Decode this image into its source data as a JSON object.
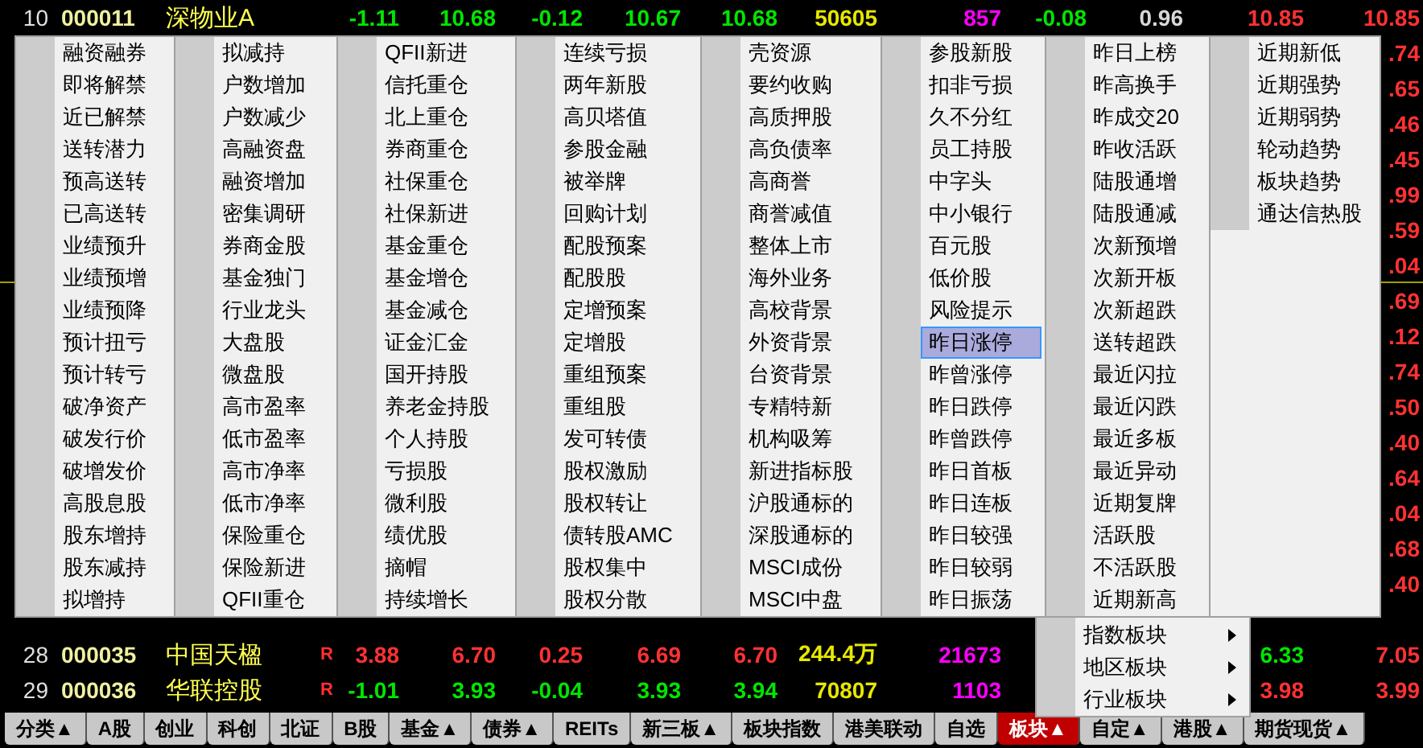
{
  "rows_top": [
    {
      "index": "10",
      "code": "000011",
      "name": "深物业A",
      "values": [
        {
          "text": "-1.11",
          "kind": "down"
        },
        {
          "text": "10.68",
          "kind": "down"
        },
        {
          "text": "-0.12",
          "kind": "down"
        },
        {
          "text": "10.67",
          "kind": "down"
        },
        {
          "text": "10.68",
          "kind": "down"
        },
        {
          "text": "50605",
          "kind": "vol"
        },
        {
          "text": "857",
          "kind": "count"
        },
        {
          "text": "-0.08",
          "kind": "down"
        },
        {
          "text": "0.96",
          "kind": "flat"
        },
        {
          "text": "10.85",
          "kind": "up"
        },
        {
          "text": "10.85",
          "kind": "up"
        }
      ]
    }
  ],
  "covered_rows": [
    {
      "fragment": ".74",
      "kind": "up",
      "divider_below": false
    },
    {
      "fragment": ".65",
      "kind": "up",
      "divider_below": false
    },
    {
      "fragment": ".46",
      "kind": "up",
      "divider_below": false
    },
    {
      "fragment": ".45",
      "kind": "up",
      "divider_below": false
    },
    {
      "fragment": ".99",
      "kind": "up",
      "divider_below": false
    },
    {
      "fragment": ".59",
      "kind": "up",
      "divider_below": false
    },
    {
      "fragment": ".04",
      "kind": "up",
      "divider_below": true
    },
    {
      "fragment": ".69",
      "kind": "up",
      "divider_below": false
    },
    {
      "fragment": ".12",
      "kind": "up",
      "divider_below": false
    },
    {
      "fragment": ".74",
      "kind": "up",
      "divider_below": false
    },
    {
      "fragment": ".50",
      "kind": "up",
      "divider_below": false
    },
    {
      "fragment": ".40",
      "kind": "up",
      "divider_below": false
    },
    {
      "fragment": ".64",
      "kind": "up",
      "divider_below": false
    },
    {
      "fragment": ".04",
      "kind": "up",
      "divider_below": false
    },
    {
      "fragment": ".68",
      "kind": "up",
      "divider_below": false
    },
    {
      "fragment": ".40",
      "kind": "up",
      "divider_below": false
    }
  ],
  "rows_bottom": [
    {
      "index": "28",
      "code": "000035",
      "name": "中国天楹",
      "flag": "R",
      "values": [
        {
          "text": "3.88",
          "kind": "up"
        },
        {
          "text": "6.70",
          "kind": "up"
        },
        {
          "text": "0.25",
          "kind": "up"
        },
        {
          "text": "6.69",
          "kind": "up"
        },
        {
          "text": "6.70",
          "kind": "up"
        },
        {
          "text": "244.4万",
          "kind": "vol"
        },
        {
          "text": "21673",
          "kind": "count"
        },
        {
          "text": "6.33",
          "kind": "down"
        },
        {
          "text": "7.05",
          "kind": "up"
        }
      ]
    },
    {
      "index": "29",
      "code": "000036",
      "name": "华联控股",
      "flag": "R",
      "values": [
        {
          "text": "-1.01",
          "kind": "down"
        },
        {
          "text": "3.93",
          "kind": "down"
        },
        {
          "text": "-0.04",
          "kind": "down"
        },
        {
          "text": "3.93",
          "kind": "down"
        },
        {
          "text": "3.94",
          "kind": "down"
        },
        {
          "text": "70807",
          "kind": "vol"
        },
        {
          "text": "1103",
          "kind": "count"
        },
        {
          "text": "3.98",
          "kind": "up"
        },
        {
          "text": "3.99",
          "kind": "up"
        }
      ]
    }
  ],
  "menu": {
    "columns": [
      [
        {
          "label": "融资融券",
          "selected": false
        },
        {
          "label": "即将解禁",
          "selected": false
        },
        {
          "label": "近已解禁",
          "selected": false
        },
        {
          "label": "送转潜力",
          "selected": false
        },
        {
          "label": "预高送转",
          "selected": false
        },
        {
          "label": "已高送转",
          "selected": false
        },
        {
          "label": "业绩预升",
          "selected": false
        },
        {
          "label": "业绩预增",
          "selected": false
        },
        {
          "label": "业绩预降",
          "selected": false
        },
        {
          "label": "预计扭亏",
          "selected": false
        },
        {
          "label": "预计转亏",
          "selected": false
        },
        {
          "label": "破净资产",
          "selected": false
        },
        {
          "label": "破发行价",
          "selected": false
        },
        {
          "label": "破增发价",
          "selected": false
        },
        {
          "label": "高股息股",
          "selected": false
        },
        {
          "label": "股东增持",
          "selected": false
        },
        {
          "label": "股东减持",
          "selected": false
        },
        {
          "label": "拟增持",
          "selected": false
        }
      ],
      [
        {
          "label": "拟减持",
          "selected": false
        },
        {
          "label": "户数增加",
          "selected": false
        },
        {
          "label": "户数减少",
          "selected": false
        },
        {
          "label": "高融资盘",
          "selected": false
        },
        {
          "label": "融资增加",
          "selected": false
        },
        {
          "label": "密集调研",
          "selected": false
        },
        {
          "label": "券商金股",
          "selected": false
        },
        {
          "label": "基金独门",
          "selected": false
        },
        {
          "label": "行业龙头",
          "selected": false
        },
        {
          "label": "大盘股",
          "selected": false
        },
        {
          "label": "微盘股",
          "selected": false
        },
        {
          "label": "高市盈率",
          "selected": false
        },
        {
          "label": "低市盈率",
          "selected": false
        },
        {
          "label": "高市净率",
          "selected": false
        },
        {
          "label": "低市净率",
          "selected": false
        },
        {
          "label": "保险重仓",
          "selected": false
        },
        {
          "label": "保险新进",
          "selected": false
        },
        {
          "label": "QFII重仓",
          "selected": false
        }
      ],
      [
        {
          "label": "QFII新进",
          "selected": false
        },
        {
          "label": "信托重仓",
          "selected": false
        },
        {
          "label": "北上重仓",
          "selected": false
        },
        {
          "label": "券商重仓",
          "selected": false
        },
        {
          "label": "社保重仓",
          "selected": false
        },
        {
          "label": "社保新进",
          "selected": false
        },
        {
          "label": "基金重仓",
          "selected": false
        },
        {
          "label": "基金增仓",
          "selected": false
        },
        {
          "label": "基金减仓",
          "selected": false
        },
        {
          "label": "证金汇金",
          "selected": false
        },
        {
          "label": "国开持股",
          "selected": false
        },
        {
          "label": "养老金持股",
          "selected": false
        },
        {
          "label": "个人持股",
          "selected": false
        },
        {
          "label": "亏损股",
          "selected": false
        },
        {
          "label": "微利股",
          "selected": false
        },
        {
          "label": "绩优股",
          "selected": false
        },
        {
          "label": "摘帽",
          "selected": false
        },
        {
          "label": "持续增长",
          "selected": false
        }
      ],
      [
        {
          "label": "连续亏损",
          "selected": false
        },
        {
          "label": "两年新股",
          "selected": false
        },
        {
          "label": "高贝塔值",
          "selected": false
        },
        {
          "label": "参股金融",
          "selected": false
        },
        {
          "label": "被举牌",
          "selected": false
        },
        {
          "label": "回购计划",
          "selected": false
        },
        {
          "label": "配股预案",
          "selected": false
        },
        {
          "label": "配股股",
          "selected": false
        },
        {
          "label": "定增预案",
          "selected": false
        },
        {
          "label": "定增股",
          "selected": false
        },
        {
          "label": "重组预案",
          "selected": false
        },
        {
          "label": "重组股",
          "selected": false
        },
        {
          "label": "发可转债",
          "selected": false
        },
        {
          "label": "股权激励",
          "selected": false
        },
        {
          "label": "股权转让",
          "selected": false
        },
        {
          "label": "债转股AMC",
          "selected": false
        },
        {
          "label": "股权集中",
          "selected": false
        },
        {
          "label": "股权分散",
          "selected": false
        }
      ],
      [
        {
          "label": "壳资源",
          "selected": false
        },
        {
          "label": "要约收购",
          "selected": false
        },
        {
          "label": "高质押股",
          "selected": false
        },
        {
          "label": "高负债率",
          "selected": false
        },
        {
          "label": "高商誉",
          "selected": false
        },
        {
          "label": "商誉减值",
          "selected": false
        },
        {
          "label": "整体上市",
          "selected": false
        },
        {
          "label": "海外业务",
          "selected": false
        },
        {
          "label": "高校背景",
          "selected": false
        },
        {
          "label": "外资背景",
          "selected": false
        },
        {
          "label": "台资背景",
          "selected": false
        },
        {
          "label": "专精特新",
          "selected": false
        },
        {
          "label": "机构吸筹",
          "selected": false
        },
        {
          "label": "新进指标股",
          "selected": false
        },
        {
          "label": "沪股通标的",
          "selected": false
        },
        {
          "label": "深股通标的",
          "selected": false
        },
        {
          "label": "MSCI成份",
          "selected": false
        },
        {
          "label": "MSCI中盘",
          "selected": false
        }
      ],
      [
        {
          "label": "参股新股",
          "selected": false
        },
        {
          "label": "扣非亏损",
          "selected": false
        },
        {
          "label": "久不分红",
          "selected": false
        },
        {
          "label": "员工持股",
          "selected": false
        },
        {
          "label": "中字头",
          "selected": false
        },
        {
          "label": "中小银行",
          "selected": false
        },
        {
          "label": "百元股",
          "selected": false
        },
        {
          "label": "低价股",
          "selected": false
        },
        {
          "label": "风险提示",
          "selected": false
        },
        {
          "label": "昨日涨停",
          "selected": true
        },
        {
          "label": "昨曾涨停",
          "selected": false
        },
        {
          "label": "昨日跌停",
          "selected": false
        },
        {
          "label": "昨曾跌停",
          "selected": false
        },
        {
          "label": "昨日首板",
          "selected": false
        },
        {
          "label": "昨日连板",
          "selected": false
        },
        {
          "label": "昨日较强",
          "selected": false
        },
        {
          "label": "昨日较弱",
          "selected": false
        },
        {
          "label": "昨日振荡",
          "selected": false
        }
      ],
      [
        {
          "label": "昨日上榜",
          "selected": false
        },
        {
          "label": "昨高换手",
          "selected": false
        },
        {
          "label": "昨成交20",
          "selected": false
        },
        {
          "label": "昨收活跃",
          "selected": false
        },
        {
          "label": "陆股通增",
          "selected": false
        },
        {
          "label": "陆股通减",
          "selected": false
        },
        {
          "label": "次新预增",
          "selected": false
        },
        {
          "label": "次新开板",
          "selected": false
        },
        {
          "label": "次新超跌",
          "selected": false
        },
        {
          "label": "送转超跌",
          "selected": false
        },
        {
          "label": "最近闪拉",
          "selected": false
        },
        {
          "label": "最近闪跌",
          "selected": false
        },
        {
          "label": "最近多板",
          "selected": false
        },
        {
          "label": "最近异动",
          "selected": false
        },
        {
          "label": "近期复牌",
          "selected": false
        },
        {
          "label": "活跃股",
          "selected": false
        },
        {
          "label": "不活跃股",
          "selected": false
        },
        {
          "label": "近期新高",
          "selected": false
        }
      ],
      [
        {
          "label": "近期新低",
          "selected": false
        },
        {
          "label": "近期强势",
          "selected": false
        },
        {
          "label": "近期弱势",
          "selected": false
        },
        {
          "label": "轮动趋势",
          "selected": false
        },
        {
          "label": "板块趋势",
          "selected": false
        },
        {
          "label": "通达信热股",
          "selected": false
        }
      ]
    ],
    "submenu_items": [
      {
        "label": "指数板块",
        "selected": false,
        "has_submenu": true
      },
      {
        "label": "地区板块",
        "selected": false,
        "has_submenu": true
      },
      {
        "label": "行业板块",
        "selected": false,
        "has_submenu": true
      }
    ]
  },
  "tabs": [
    {
      "label": "分类▲",
      "selected": false
    },
    {
      "label": "A股",
      "selected": false
    },
    {
      "label": "创业",
      "selected": false
    },
    {
      "label": "科创",
      "selected": false
    },
    {
      "label": "北证",
      "selected": false
    },
    {
      "label": "B股",
      "selected": false
    },
    {
      "label": "基金▲",
      "selected": false
    },
    {
      "label": "债券▲",
      "selected": false
    },
    {
      "label": "REITs",
      "selected": false
    },
    {
      "label": "新三板▲",
      "selected": false
    },
    {
      "label": "板块指数",
      "selected": false
    },
    {
      "label": "港美联动",
      "selected": false
    },
    {
      "label": "自选",
      "selected": false
    },
    {
      "label": "板块▲",
      "selected": true
    },
    {
      "label": "自定▲",
      "selected": false
    },
    {
      "label": "港股▲",
      "selected": false
    },
    {
      "label": "期货现货▲",
      "selected": false
    }
  ]
}
